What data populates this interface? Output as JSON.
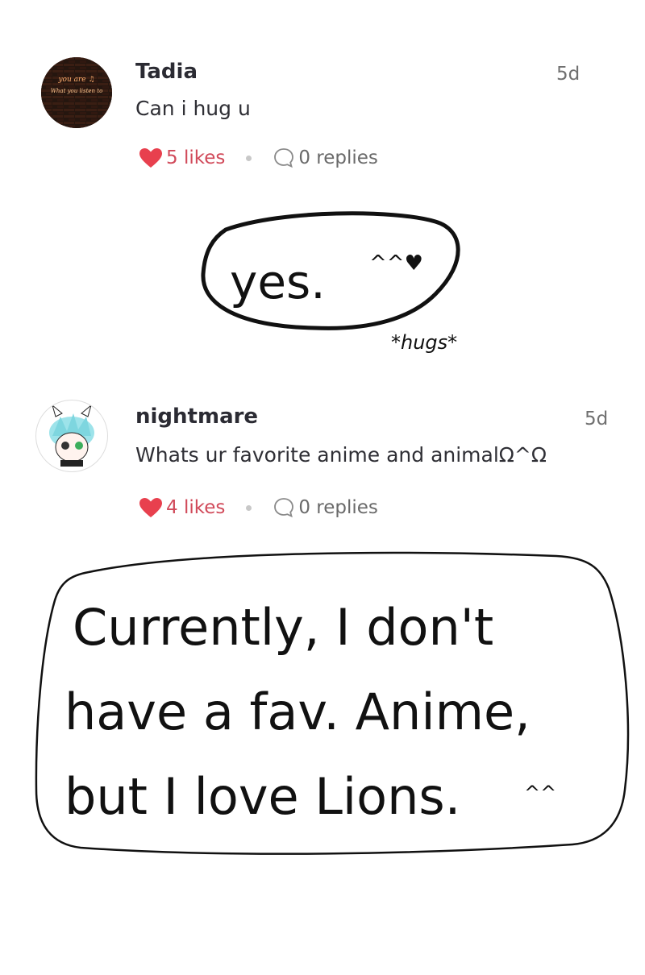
{
  "comments": [
    {
      "username": "Tadia",
      "time": "5d",
      "text": "Can i hug u",
      "likes": "5 likes",
      "replies": "0 replies",
      "avatar_text": [
        "you are ♫",
        "What you listen to"
      ]
    },
    {
      "username": "nightmare",
      "time": "5d",
      "text": "Whats ur favorite anime and animalΩ^Ω",
      "likes": "4 likes",
      "replies": "0 replies"
    }
  ],
  "drawings": {
    "reply1": {
      "main": "yes.",
      "emote": "^^♥",
      "action": "*hugs*"
    },
    "reply2": {
      "lines": [
        "Currently, I don't",
        "have a fav. Anime,",
        "but I love Lions."
      ],
      "emote": "^^"
    }
  },
  "colors": {
    "like": "#e8404e",
    "text": "#2f2f35",
    "muted": "#707070"
  }
}
